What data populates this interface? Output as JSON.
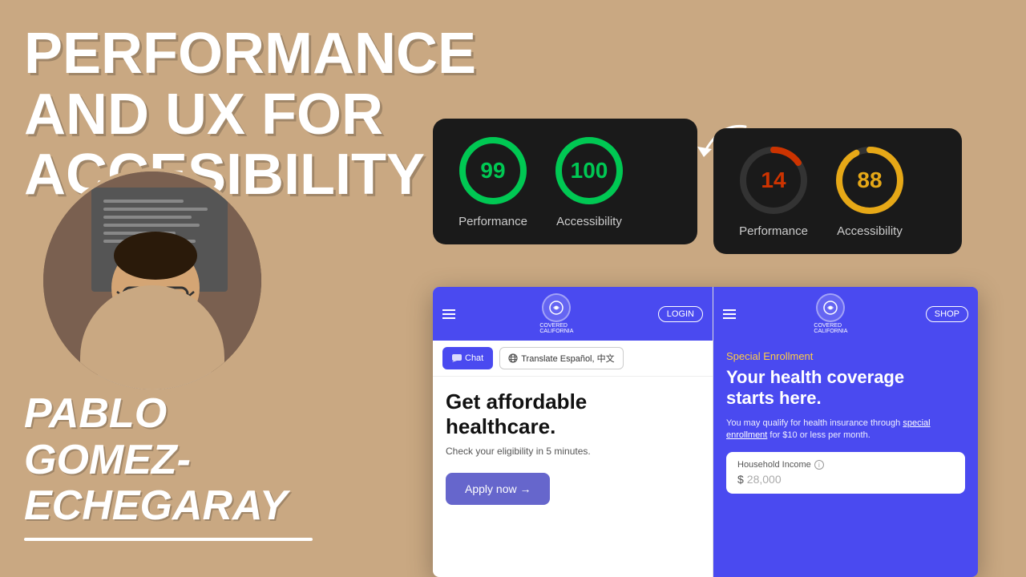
{
  "title": {
    "line1": "PERFORMANCE AND UX FOR",
    "line2": "ACCESIBILITY"
  },
  "presenter": {
    "name_line1": "PABLO",
    "name_line2": "GOMEZ-",
    "name_line3": "ECHEGARAY"
  },
  "score_good": {
    "performance_score": "99",
    "accessibility_score": "100",
    "performance_label": "Performance",
    "accessibility_label": "Accessibility"
  },
  "score_bad": {
    "performance_score": "14",
    "accessibility_score": "88",
    "performance_label": "Performance",
    "accessibility_label": "Accessibility"
  },
  "mockup_good": {
    "nav_button": "LOGIN",
    "chat_button": "Chat",
    "translate_button": "Translate Español, 中文",
    "headline_line1": "Get affordable",
    "headline_line2": "healthcare.",
    "subtext": "Check your eligibility in 5 minutes.",
    "apply_button": "Apply now →"
  },
  "mockup_bad": {
    "nav_button": "SHOP",
    "special_enrollment": "Special Enrollment",
    "headline_line1": "Your health coverage",
    "headline_line2": "starts here.",
    "subtext": "You may qualify for health insurance through special enrollment for $10 or less per month.",
    "income_label": "Household Income",
    "income_placeholder": "28,000"
  },
  "colors": {
    "bg": "#c9a882",
    "score_good_green": "#00c853",
    "score_bad_red": "#cc3300",
    "score_bad_orange": "#e6a817",
    "card_bg": "#1a1a1a",
    "purple": "#4a4af0"
  }
}
